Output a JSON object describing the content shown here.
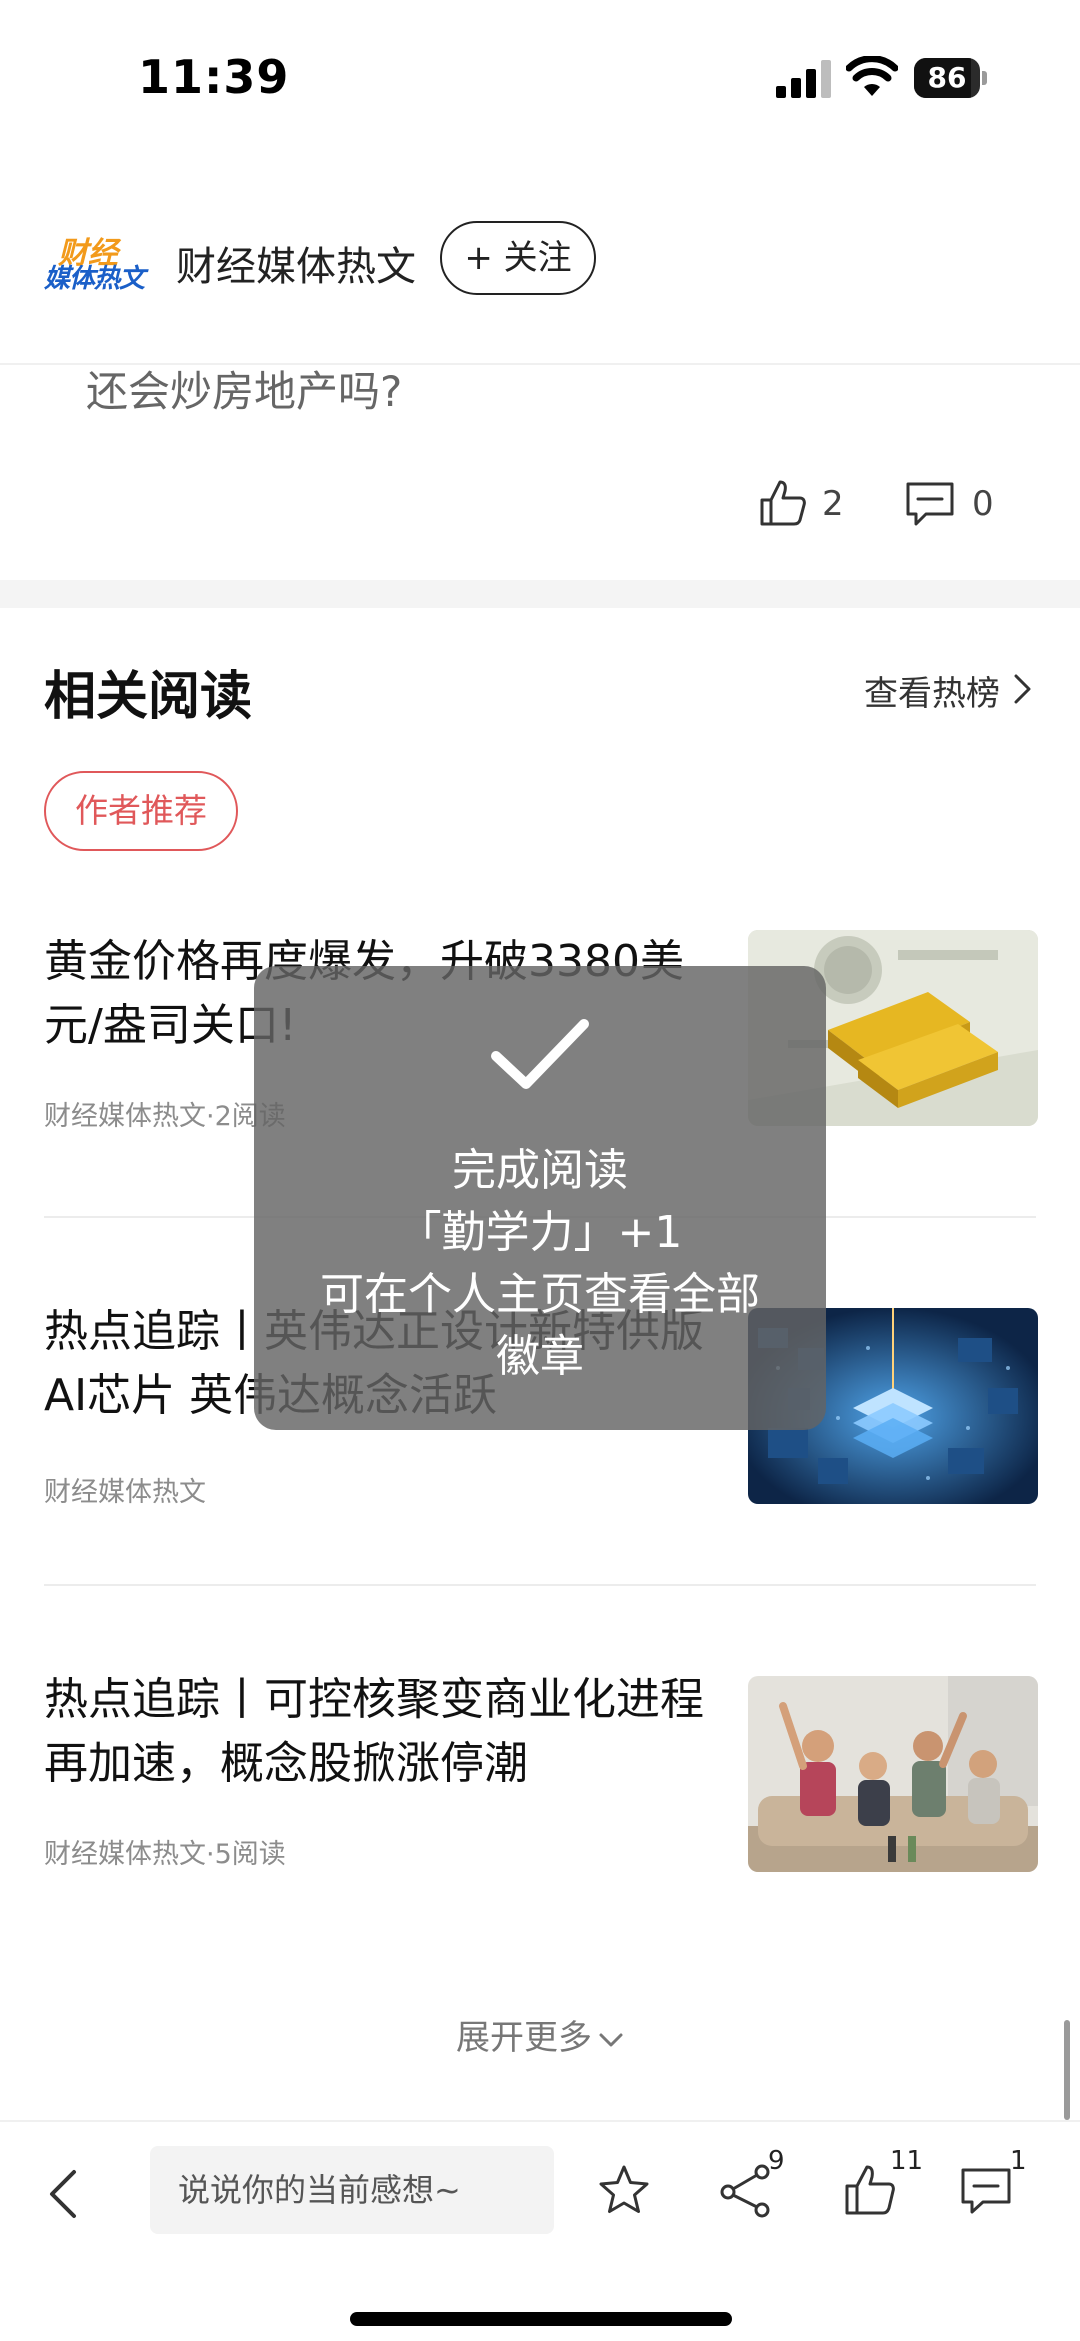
{
  "status_bar": {
    "time": "11:39",
    "battery": "86",
    "battery_level": 0.86
  },
  "author": {
    "logo_line1": "财经",
    "logo_line2": "媒体热文",
    "name": "财经媒体热文",
    "follow_label": "+ 关注"
  },
  "article_tail": {
    "text": "还会炒房地产吗?",
    "likes": "2",
    "comments": "0"
  },
  "related": {
    "title": "相关阅读",
    "hot_list_label": "查看热榜",
    "tag": "作者推荐",
    "articles": [
      {
        "title": "黄金价格再度爆发，升破3380美元/盎司关口!",
        "meta": "财经媒体热文·2阅读",
        "thumb": "gold-bars-on-dollars"
      },
      {
        "title": "热点追踪丨英伟达正设计新特供版AI芯片 英伟达概念活跃",
        "meta": "财经媒体热文",
        "thumb": "ai-chip-circuit"
      },
      {
        "title": "热点追踪丨可控核聚变商业化进程再加速，概念股掀涨停潮",
        "meta": "财经媒体热文·5阅读",
        "thumb": "cheering-friends"
      }
    ],
    "expand_label": "展开更多"
  },
  "toast": {
    "line1": "完成阅读",
    "line2": "「勤学力」+1",
    "line3": "可在个人主页查看全部",
    "line4": "徽章"
  },
  "bottom_bar": {
    "input_placeholder": "说说你的当前感想~",
    "share_count": "9",
    "like_count": "11",
    "comment_count": "1",
    "icons": [
      "back-icon",
      "star-icon",
      "share-icon",
      "thumbs-up-icon",
      "comment-icon"
    ]
  },
  "colors": {
    "accent_red": "#e0585a",
    "logo_orange": "#f29a1b",
    "logo_blue": "#1a5fc8"
  }
}
